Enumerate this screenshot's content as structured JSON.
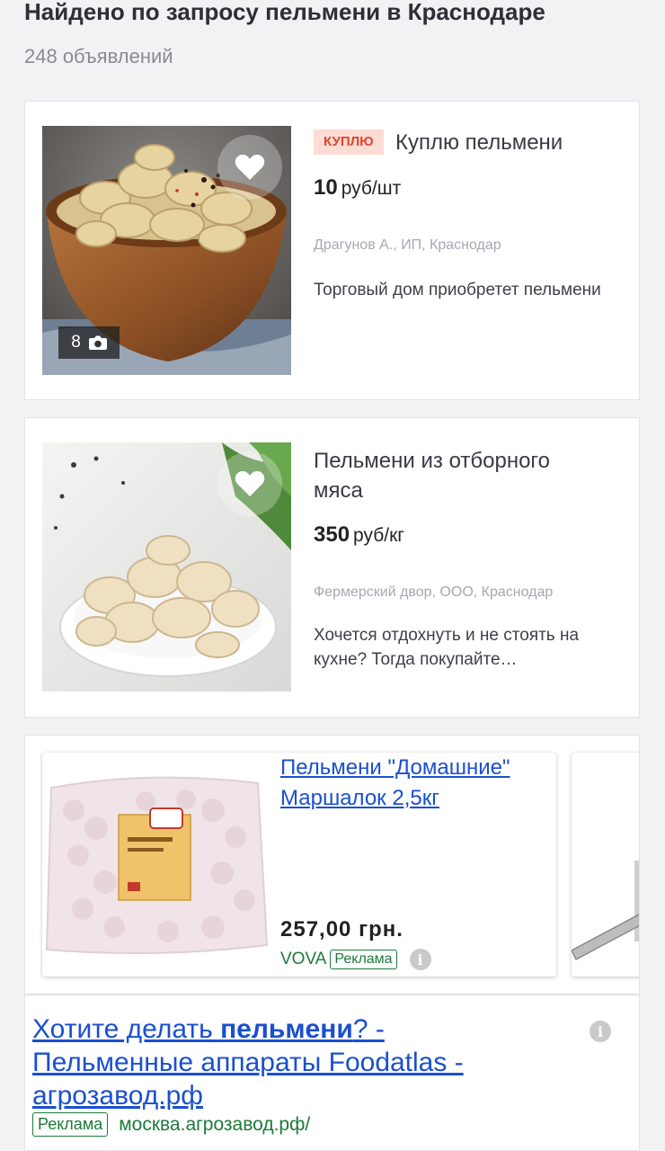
{
  "header": {
    "title": "Найдено по запросу пельмени в Краснодаре",
    "count": "248 объявлений"
  },
  "listings": [
    {
      "tag": "КУПЛЮ",
      "title": "Куплю пельмени",
      "price_value": "10",
      "price_unit": "руб/шт",
      "seller": "Драгунов А., ИП, Краснодар",
      "description": "Торговый дом приобретет пельмени",
      "photo_count": "8"
    },
    {
      "title": "Пельмени из отборного мяса",
      "price_value": "350",
      "price_unit": "руб/кг",
      "seller": "Фермерский двор, ООО, Краснодар",
      "description": "Хочется отдохнуть и не стоять на кухне? Тогда покупайте…"
    }
  ],
  "shopping_ad": {
    "title": "Пельмени \"Домашние\" Маршалок 2,5кг",
    "price": "257,00 грн.",
    "vendor": "VOVA",
    "badge": "Реклама"
  },
  "text_ad": {
    "title_prefix": "Хотите делать ",
    "title_bold": "пельмени",
    "title_suffix": "? - Пельменные аппараты Foodatlas - агрозавод.рф",
    "badge": "Реклама",
    "url": "москва.агрозавод.рф/"
  },
  "icons": {
    "favorite": "heart-icon",
    "photos": "camera-icon",
    "info": "info-icon"
  },
  "colors": {
    "link": "#1a4fd0",
    "ad_green": "#1d7a3a",
    "tag_bg": "#fcdcd5",
    "tag_text": "#e0462a"
  }
}
